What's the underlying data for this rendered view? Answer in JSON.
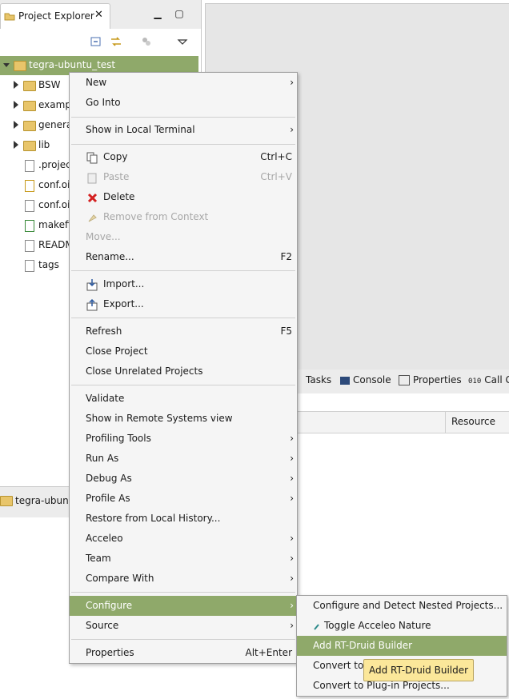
{
  "explorer": {
    "tab_title": "Project Explorer",
    "tree": [
      {
        "label": "tegra-ubuntu_test",
        "kind": "project"
      },
      {
        "label": "BSW",
        "kind": "folder"
      },
      {
        "label": "examp",
        "kind": "folder"
      },
      {
        "label": "genera",
        "kind": "folder"
      },
      {
        "label": "lib",
        "kind": "folder"
      },
      {
        "label": ".projec",
        "kind": "file"
      },
      {
        "label": "conf.oi",
        "kind": "file"
      },
      {
        "label": "conf.oi",
        "kind": "file"
      },
      {
        "label": "makefi",
        "kind": "file"
      },
      {
        "label": "READM",
        "kind": "file"
      },
      {
        "label": "tags",
        "kind": "file"
      }
    ],
    "status_text": "tegra-ubuntu"
  },
  "bottom_panel": {
    "tabs": [
      "Tasks",
      "Console",
      "Properties",
      "Call G"
    ],
    "column_header": "Resource"
  },
  "context_menu": {
    "items": [
      {
        "label": "New",
        "submenu": true
      },
      {
        "label": "Go Into"
      },
      {
        "label": "Show in Local Terminal",
        "submenu": true
      },
      {
        "label": "Copy",
        "shortcut": "Ctrl+C",
        "icon": "copy-icon"
      },
      {
        "label": "Paste",
        "shortcut": "Ctrl+V",
        "icon": "paste-icon",
        "disabled": true
      },
      {
        "label": "Delete",
        "icon": "delete-icon"
      },
      {
        "label": "Remove from Context",
        "icon": "remove-context-icon",
        "disabled": true
      },
      {
        "label": "Move...",
        "disabled": true
      },
      {
        "label": "Rename...",
        "shortcut": "F2"
      },
      {
        "label": "Import...",
        "icon": "import-icon"
      },
      {
        "label": "Export...",
        "icon": "export-icon"
      },
      {
        "label": "Refresh",
        "shortcut": "F5"
      },
      {
        "label": "Close Project"
      },
      {
        "label": "Close Unrelated Projects"
      },
      {
        "label": "Validate"
      },
      {
        "label": "Show in Remote Systems view"
      },
      {
        "label": "Profiling Tools",
        "submenu": true
      },
      {
        "label": "Run As",
        "submenu": true
      },
      {
        "label": "Debug As",
        "submenu": true
      },
      {
        "label": "Profile As",
        "submenu": true
      },
      {
        "label": "Restore from Local History..."
      },
      {
        "label": "Acceleo",
        "submenu": true
      },
      {
        "label": "Team",
        "submenu": true
      },
      {
        "label": "Compare With",
        "submenu": true
      },
      {
        "label": "Configure",
        "submenu": true,
        "selected": true
      },
      {
        "label": "Source",
        "submenu": true
      },
      {
        "label": "Properties",
        "shortcut": "Alt+Enter"
      }
    ]
  },
  "configure_submenu": {
    "items": [
      {
        "label": "Configure and Detect Nested Projects..."
      },
      {
        "label": "Toggle Acceleo Nature",
        "icon": "acceleo-icon"
      },
      {
        "label": "Add RT-Druid Builder",
        "selected": true
      },
      {
        "label": "Convert to X"
      },
      {
        "label": "Convert to Plug-in Projects..."
      }
    ]
  },
  "tooltip": "Add RT-Druid Builder",
  "colors": {
    "selection": "#8fa96a",
    "menu_bg": "#f5f5f5",
    "tooltip_bg": "#fbe79a"
  }
}
